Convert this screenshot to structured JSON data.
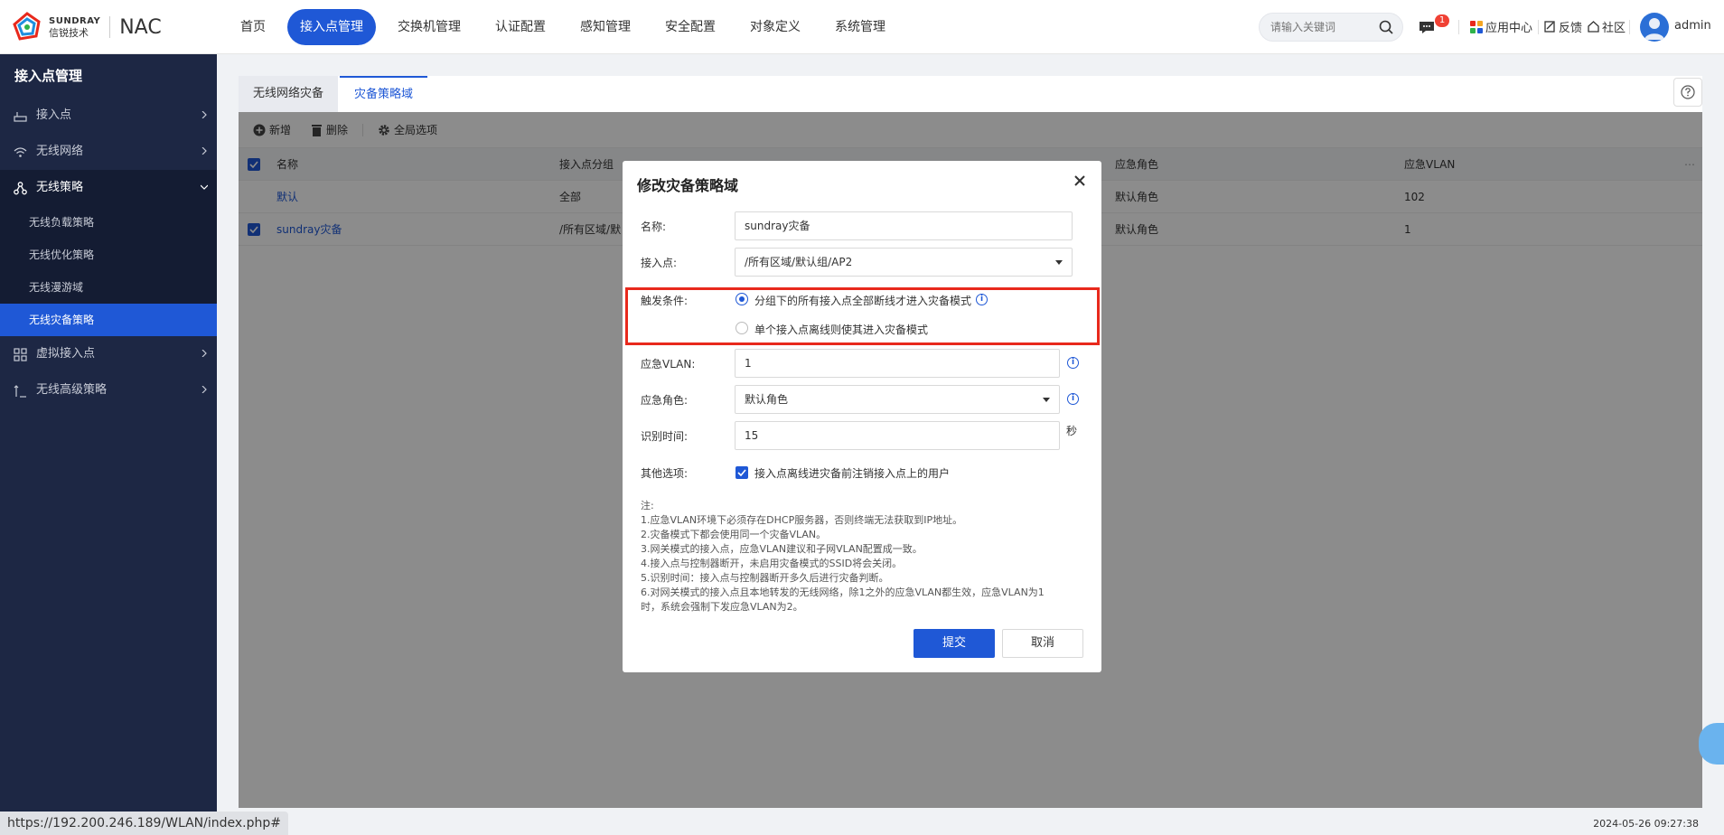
{
  "brand": {
    "logo_en": "SUNDRAY",
    "logo_cn": "信锐技术",
    "product": "NAC"
  },
  "nav": [
    {
      "label": "首页",
      "active": false
    },
    {
      "label": "接入点管理",
      "active": true
    },
    {
      "label": "交换机管理",
      "active": false
    },
    {
      "label": "认证配置",
      "active": false
    },
    {
      "label": "感知管理",
      "active": false
    },
    {
      "label": "安全配置",
      "active": false
    },
    {
      "label": "对象定义",
      "active": false
    },
    {
      "label": "系统管理",
      "active": false
    }
  ],
  "search": {
    "placeholder": "请输入关键词"
  },
  "topbar": {
    "msg_count": "1",
    "app_center": "应用中心",
    "feedback": "反馈",
    "community": "社区",
    "user": "admin"
  },
  "sidebar": {
    "title": "接入点管理",
    "items": [
      {
        "label": "接入点",
        "icon": "router-icon"
      },
      {
        "label": "无线网络",
        "icon": "wifi-icon"
      },
      {
        "label": "无线策略",
        "icon": "network-icon"
      },
      {
        "label": "虚拟接入点",
        "icon": "grid-icon"
      },
      {
        "label": "无线高级策略",
        "icon": "advanced-icon"
      }
    ],
    "subitems": [
      "无线负载策略",
      "无线优化策略",
      "无线漫游域",
      "无线灾备策略"
    ]
  },
  "tabs": [
    "无线网络灾备",
    "灾备策略域"
  ],
  "toolbar": {
    "add": "新增",
    "delete": "删除",
    "global": "全局选项"
  },
  "grid": {
    "columns": [
      "名称",
      "接入点分组",
      "",
      "应急角色",
      "应急VLAN"
    ],
    "rows": [
      {
        "name": "默认",
        "group": "全部",
        "role": "默认角色",
        "vlan": "102"
      },
      {
        "name": "sundray灾备",
        "group": "/所有区域/默",
        "role": "默认角色",
        "vlan": "1"
      }
    ]
  },
  "dialog": {
    "title": "修改灾备策略域",
    "name_label": "名称:",
    "name_value": "sundray灾备",
    "ap_label": "接入点:",
    "ap_value": "/所有区域/默认组/AP2",
    "trigger_label": "触发条件:",
    "trigger_opt1": "分组下的所有接入点全部断线才进入灾备模式",
    "trigger_opt2": "单个接入点离线则使其进入灾备模式",
    "vlan_label": "应急VLAN:",
    "vlan_value": "1",
    "role_label": "应急角色:",
    "role_value": "默认角色",
    "time_label": "识别时间:",
    "time_value": "15",
    "time_unit": "秒",
    "other_label": "其他选项:",
    "other_value": "接入点离线进灾备前注销接入点上的用户",
    "notes": [
      "注:",
      "1.应急VLAN环境下必须存在DHCP服务器，否则终端无法获取到IP地址。",
      "2.灾备模式下都会使用同一个灾备VLAN。",
      "3.网关模式的接入点，应急VLAN建议和子网VLAN配置成一致。",
      "4.接入点与控制器断开，未启用灾备模式的SSID将会关闭。",
      "5.识别时间：接入点与控制器断开多久后进行灾备判断。",
      "6.对网关模式的接入点且本地转发的无线网络，除1之外的应急VLAN都生效，应急VLAN为1",
      "时，系统会强制下发应急VLAN为2。"
    ],
    "submit": "提交",
    "cancel": "取消"
  },
  "status": {
    "url": "https://192.200.246.189/WLAN/index.php#",
    "datetime": "2024-05-26 09:27:38"
  }
}
